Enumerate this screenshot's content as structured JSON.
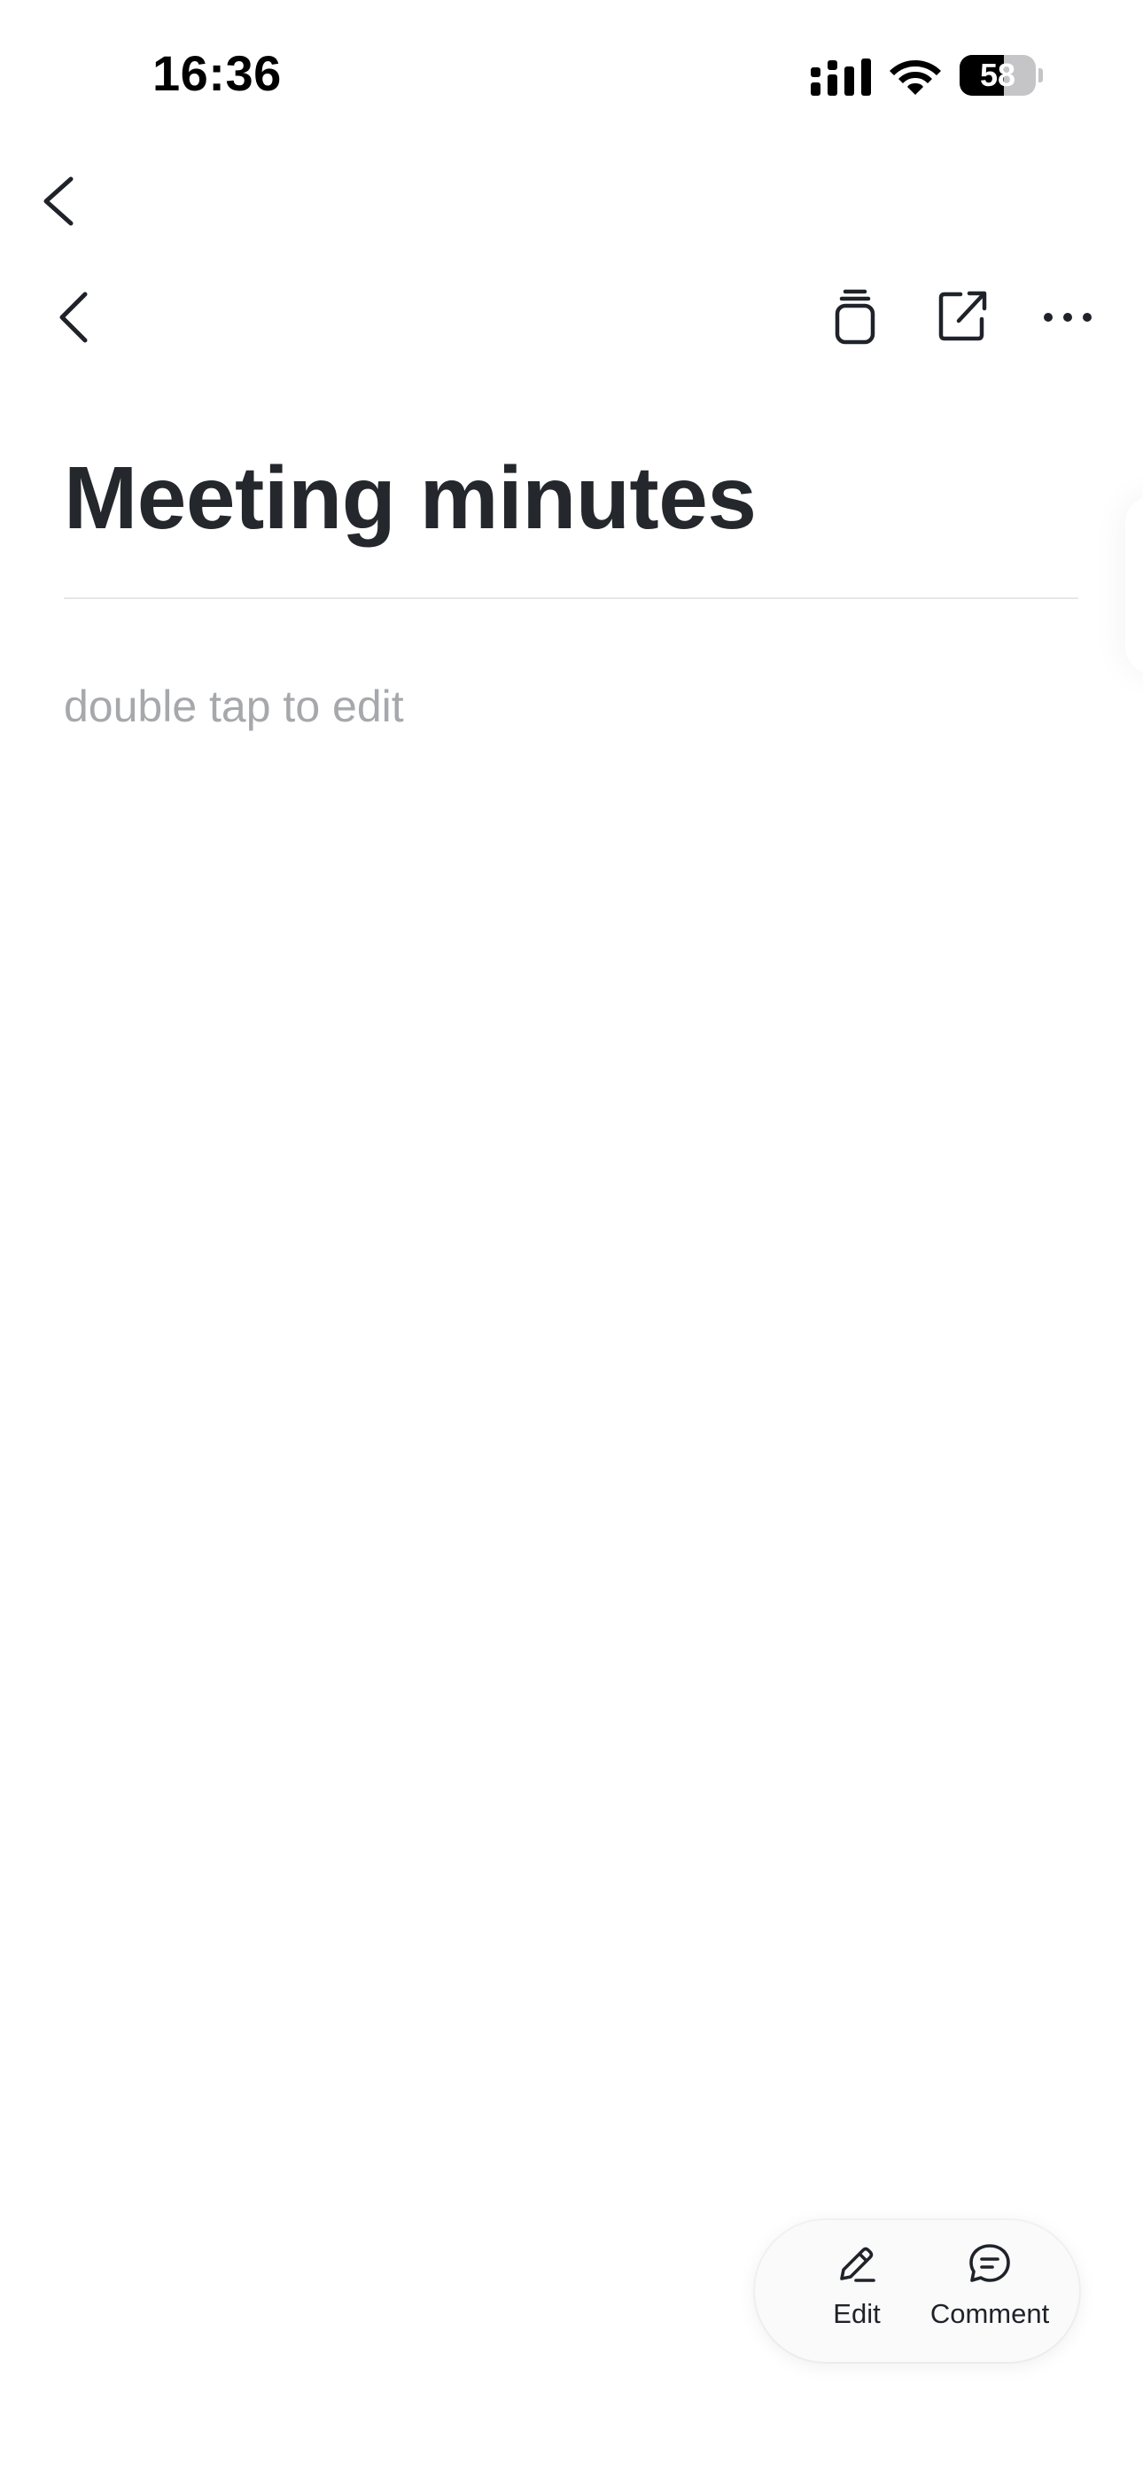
{
  "status_bar": {
    "time": "16:36",
    "battery_level": "58",
    "battery_fraction": 0.58
  },
  "icons": {
    "outer_back": "chevron-left-icon",
    "doc_back": "chevron-left-icon",
    "pages": "stacked-pages-icon",
    "share": "share-external-icon",
    "more": "more-horizontal-icon",
    "edit": "pencil-icon",
    "comment": "comment-bubble-icon"
  },
  "document": {
    "title": "Meeting minutes",
    "placeholder": "double tap to edit"
  },
  "actions": {
    "edit_label": "Edit",
    "comment_label": "Comment"
  },
  "colors": {
    "title": "#24272b",
    "placeholder": "#a6a8ab",
    "divider": "#e6e7ea",
    "pill_background": "#fafafb"
  }
}
